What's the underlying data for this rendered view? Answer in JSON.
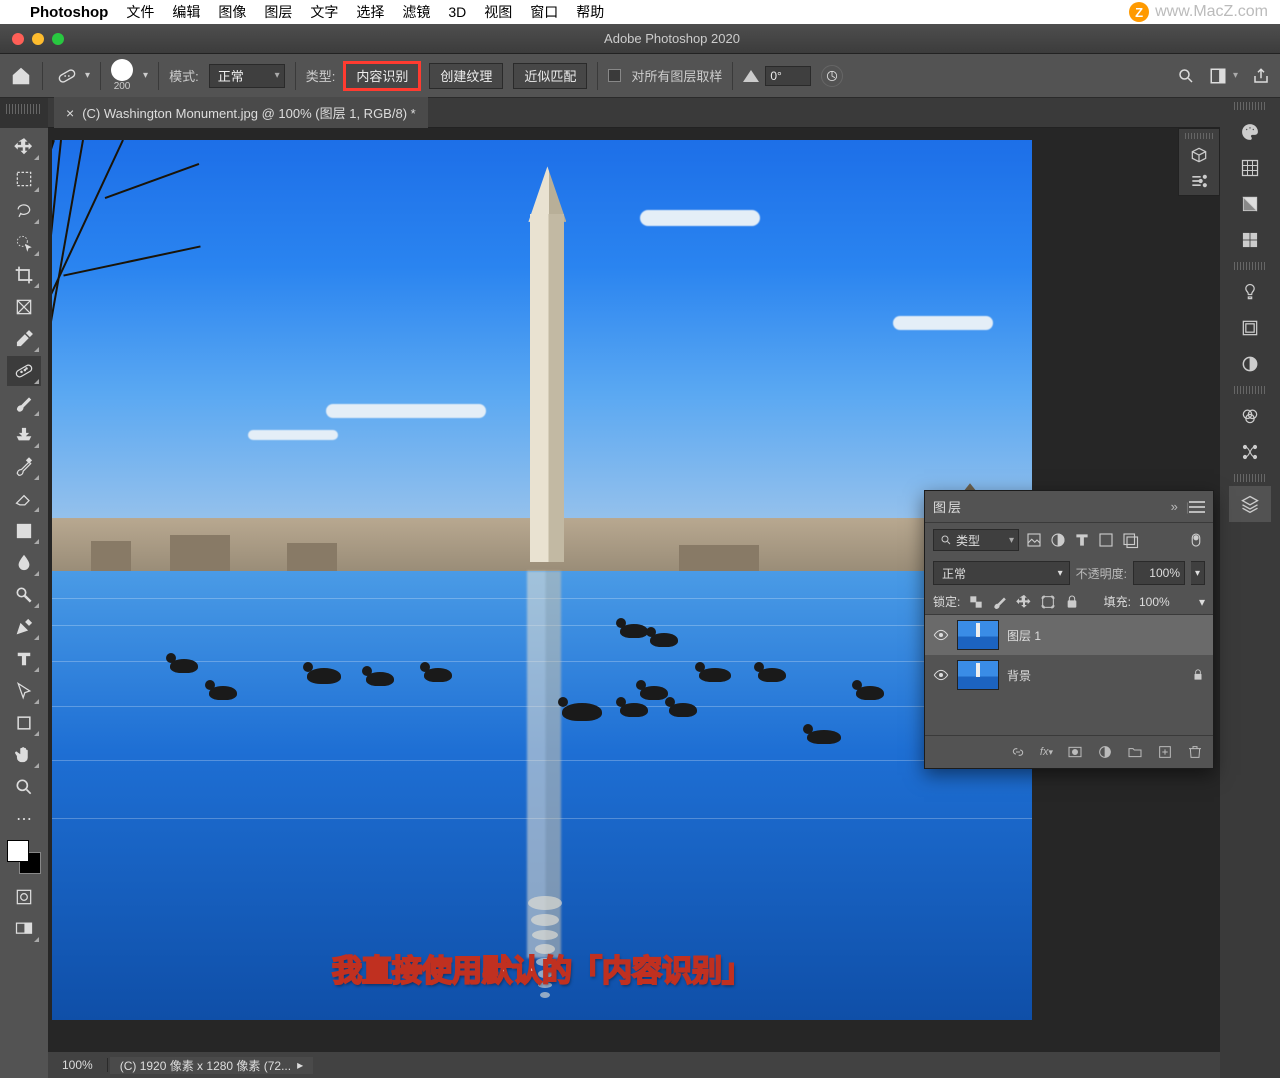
{
  "menubar": {
    "app": "Photoshop",
    "items": [
      "文件",
      "编辑",
      "图像",
      "图层",
      "文字",
      "选择",
      "滤镜",
      "3D",
      "视图",
      "窗口",
      "帮助"
    ]
  },
  "watermark": "www.MacZ.com",
  "window": {
    "title": "Adobe Photoshop 2020"
  },
  "options": {
    "brush_size": "200",
    "mode_label": "模式:",
    "mode_value": "正常",
    "type_label": "类型:",
    "btn_content_aware": "内容识别",
    "btn_create_texture": "创建纹理",
    "btn_proximity": "近似匹配",
    "sample_all_label": "对所有图层取样",
    "angle_value": "0°"
  },
  "tab": {
    "title": "(C) Washington Monument.jpg @ 100% (图层 1, RGB/8) *"
  },
  "status": {
    "zoom": "100%",
    "info": "(C) 1920 像素 x 1280 像素 (72..."
  },
  "layers_panel": {
    "title": "图层",
    "filter_label": "类型",
    "blend_mode": "正常",
    "opacity_label": "不透明度:",
    "opacity_value": "100%",
    "lock_label": "锁定:",
    "fill_label": "填充:",
    "fill_value": "100%",
    "layers": [
      {
        "name": "图层 1",
        "selected": true,
        "locked": false
      },
      {
        "name": "背景",
        "selected": false,
        "locked": true
      }
    ]
  },
  "caption": "我直接使用默认的「内容识别」",
  "tool_names": [
    "move",
    "marquee",
    "lasso",
    "magic-wand",
    "crop",
    "frame",
    "eyedropper",
    "spot-healing",
    "brush",
    "clone",
    "history-brush",
    "eraser",
    "gradient",
    "blur",
    "dodge",
    "pen",
    "type",
    "path-select",
    "rectangle",
    "hand",
    "zoom",
    "edit-toolbar"
  ],
  "right_tabs": [
    "color",
    "swatches",
    "gradients",
    "patterns",
    "bulb",
    "libraries",
    "adjustments",
    "channels",
    "paths",
    "layers"
  ]
}
